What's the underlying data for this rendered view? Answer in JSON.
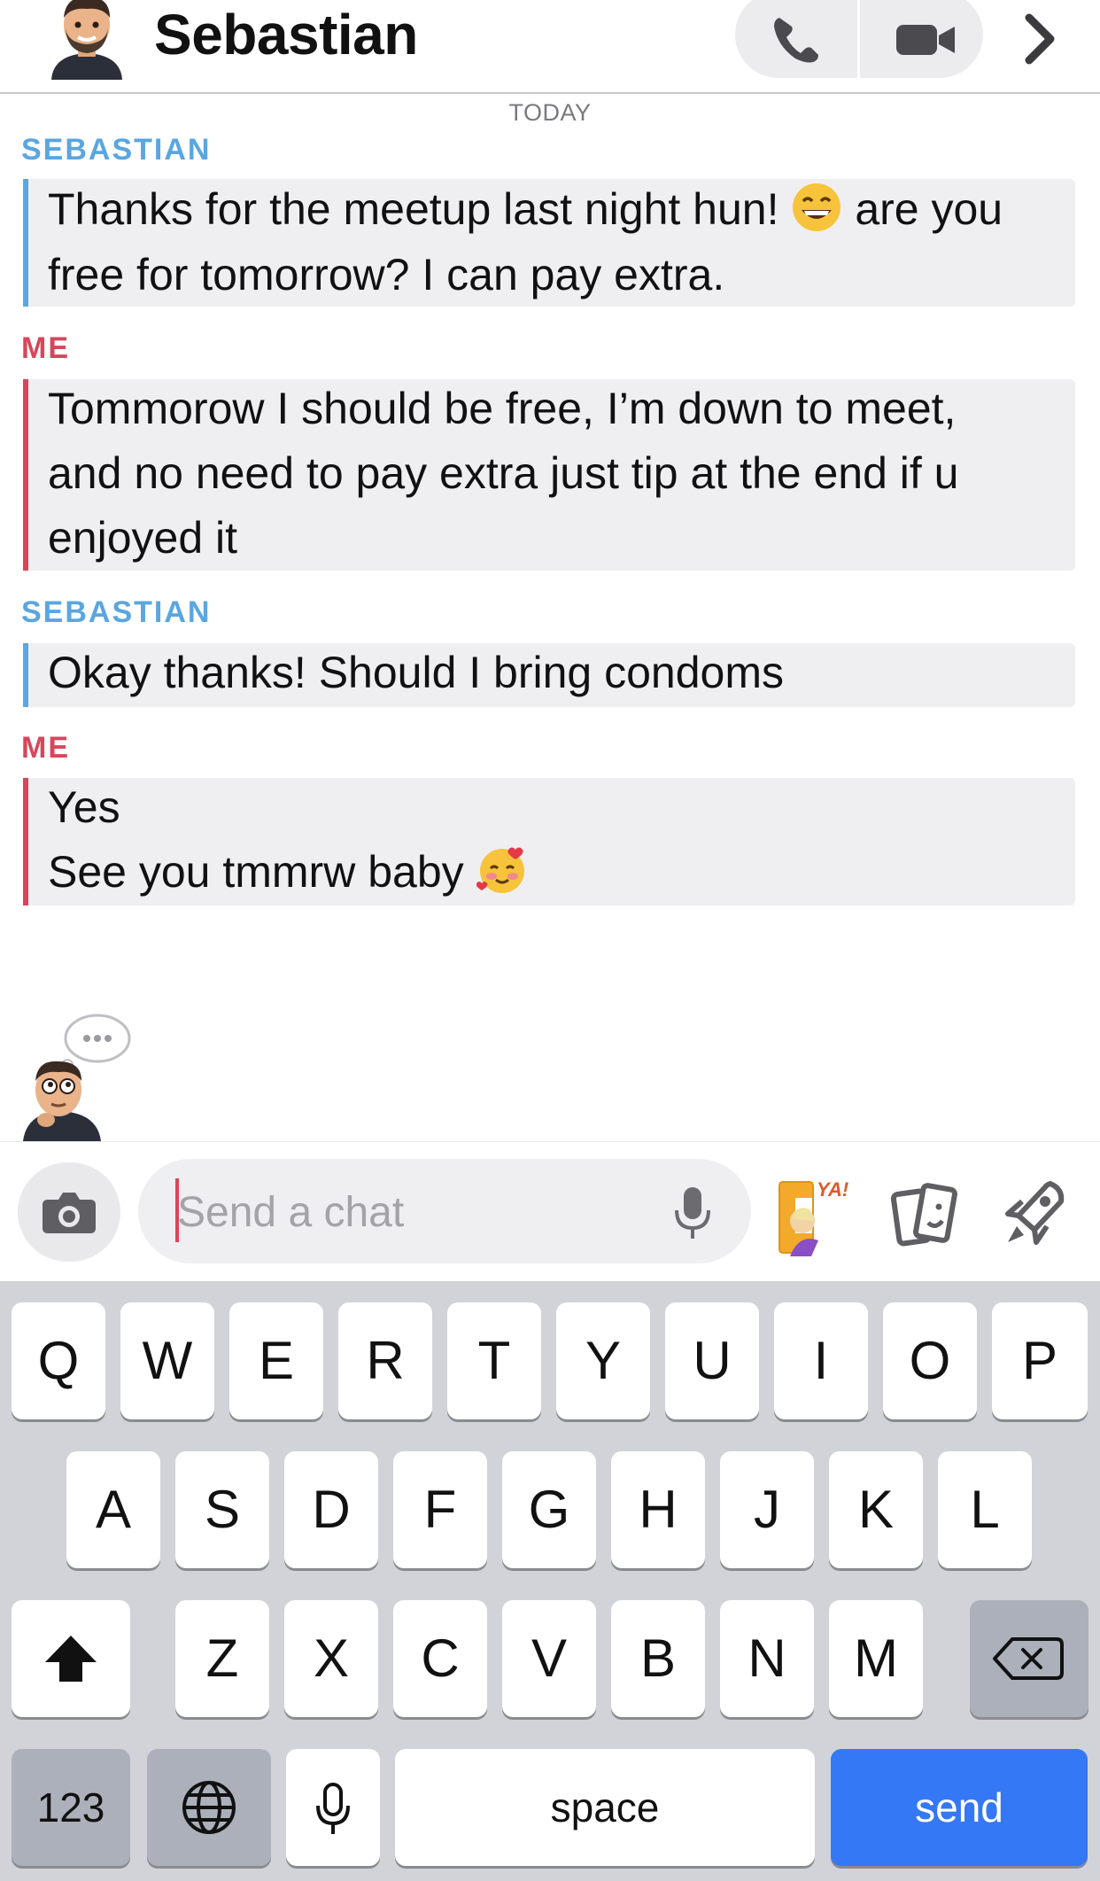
{
  "header": {
    "contact_name": "Sebastian",
    "avatar_icon": "bitmoji-avatar-icon",
    "phone_icon": "phone-icon",
    "video_icon": "video-camera-icon",
    "more_icon": "chevron-right-icon"
  },
  "chat": {
    "date_label": "TODAY",
    "messages": [
      {
        "sender": "SEBASTIAN",
        "line1a": "Thanks for the meetup last night hun!",
        "emoji1": "grinning-face-emoji",
        "line1b": "are you",
        "line2": "free for tomorrow? I can pay extra."
      },
      {
        "sender": "ME",
        "line1": "Tommorow I should be free, I’m down to meet,",
        "line2": "and no need to pay extra just tip at the end if u",
        "line3": "enjoyed it"
      },
      {
        "sender": "SEBASTIAN",
        "line1": "Okay thanks! Should I bring condoms"
      },
      {
        "sender": "ME",
        "line1": "Yes",
        "line2": "See you tmmrw baby",
        "emoji2": "smiling-face-with-hearts-emoji"
      }
    ],
    "typing_indicator_icon": "bitmoji-thinking-icon"
  },
  "composer": {
    "placeholder": "Send a chat",
    "camera_icon": "camera-icon",
    "mic_icon": "microphone-icon",
    "bitmoji_sticker_text": "YA!",
    "sticker_icon": "sticker-cards-icon",
    "games_icon": "rocket-games-icon"
  },
  "keyboard": {
    "row1": [
      "Q",
      "W",
      "E",
      "R",
      "T",
      "Y",
      "U",
      "I",
      "O",
      "P"
    ],
    "row2": [
      "A",
      "S",
      "D",
      "F",
      "G",
      "H",
      "J",
      "K",
      "L"
    ],
    "row3": [
      "Z",
      "X",
      "C",
      "V",
      "B",
      "N",
      "M"
    ],
    "numbers_label": "123",
    "space_label": "space",
    "send_label": "send",
    "shift_icon": "shift-arrow-icon",
    "delete_icon": "backspace-icon",
    "globe_icon": "globe-icon",
    "dictation_icon": "microphone-icon"
  },
  "colors": {
    "sebastian": "#5aa6e0",
    "me": "#d8465a",
    "send_key": "#3478f6"
  }
}
